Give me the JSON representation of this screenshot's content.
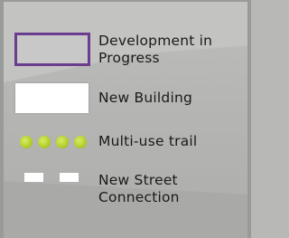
{
  "legend": {
    "items": [
      {
        "symbol": "development-outline",
        "label_line1": "Development in",
        "label_line2": "Progress",
        "stroke_color": "#6a3d8e",
        "fill_color": "#c9c8c8"
      },
      {
        "symbol": "white-rectangle",
        "label_line1": "New Building",
        "fill_color": "#ffffff"
      },
      {
        "symbol": "green-dots",
        "label_line1": "Multi-use trail",
        "fill_color": "#b6d12c"
      },
      {
        "symbol": "white-dashes",
        "label_line1": "New Street",
        "label_line2": "Connection",
        "fill_color": "#ffffff"
      }
    ]
  }
}
